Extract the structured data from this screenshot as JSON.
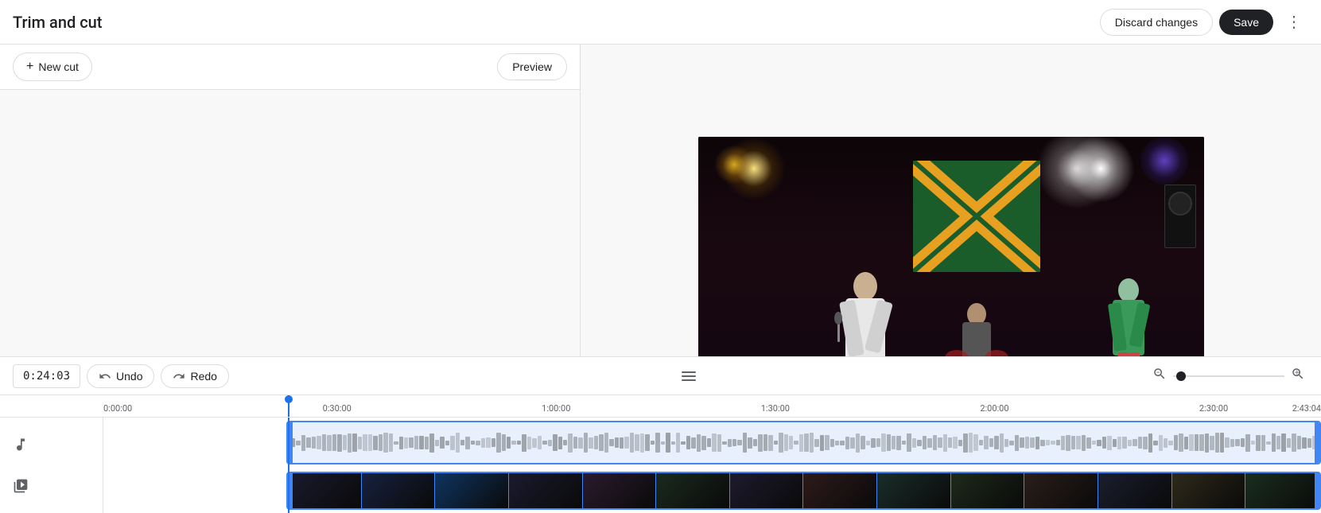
{
  "header": {
    "title": "Trim and cut",
    "discard_label": "Discard changes",
    "save_label": "Save"
  },
  "toolbar": {
    "new_cut_label": "New cut",
    "preview_label": "Preview"
  },
  "timeline": {
    "time_display": "0:24:03",
    "undo_label": "Undo",
    "redo_label": "Redo",
    "ruler_marks": [
      "0:00:00",
      "0:30:00",
      "1:00:00",
      "1:30:00",
      "2:00:00",
      "2:30:00",
      "2:43:04"
    ]
  }
}
